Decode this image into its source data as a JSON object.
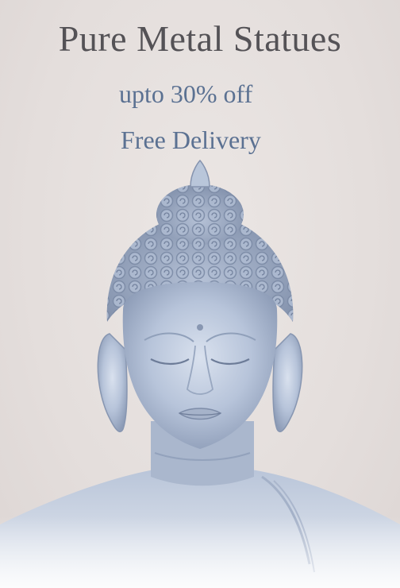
{
  "banner": {
    "headline": "Pure Metal Statues",
    "offer": "upto 30% off",
    "delivery": "Free Delivery"
  },
  "image": {
    "subject": "buddha-head-statue-icon"
  },
  "colors": {
    "background": "#e6e0de",
    "headline": "#545256",
    "accent": "#5b7192",
    "statue": "#b7c4da"
  }
}
